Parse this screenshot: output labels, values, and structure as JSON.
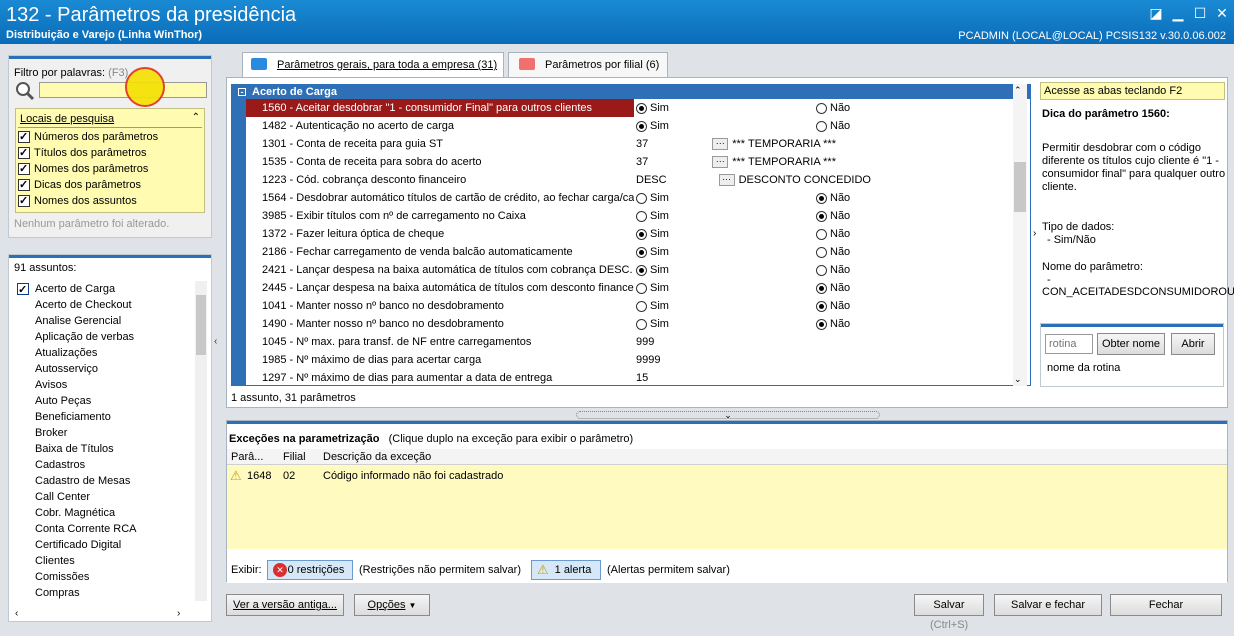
{
  "window": {
    "title": "132 - Parâmetros da presidência",
    "subtitle": "Distribuição e Varejo (Linha WinThor)",
    "user_info": "PCADMIN (LOCAL@LOCAL)   PCSIS132  v.30.0.06.002"
  },
  "filter": {
    "label": "Filtro por palavras:",
    "shortcut": "(F3)",
    "value": "",
    "locais_title": "Locais de pesquisa",
    "options": [
      "Números dos parâmetros",
      "Títulos dos parâmetros",
      "Nomes dos parâmetros",
      "Dicas dos parâmetros",
      "Nomes dos assuntos"
    ],
    "status": "Nenhum parâmetro foi alterado."
  },
  "subjects": {
    "count_label": "91 assuntos:",
    "items": [
      "Acerto de Carga",
      "Acerto de Checkout",
      "Analise Gerencial",
      "Aplicação de verbas",
      "Atualizações",
      "Autosserviço",
      "Avisos",
      "Auto Peças",
      "Beneficiamento",
      "Broker",
      "Baixa de Títulos",
      "Cadastros",
      "Cadastro de Mesas",
      "Call Center",
      "Cobr. Magnética",
      "Conta Corrente RCA",
      "Certificado Digital",
      "Clientes",
      "Comissões",
      "Compras"
    ]
  },
  "tabs": [
    {
      "label": "Parâmetros gerais, para toda a empresa (31)"
    },
    {
      "label": "Parâmetros por filial  (6)"
    }
  ],
  "grid": {
    "group": "Acerto de Carga",
    "rows": [
      {
        "name": "1560 - Aceitar desdobrar \"1 - consumidor Final\" para outros clientes",
        "v1": "Sim",
        "v2": "Não"
      },
      {
        "name": "1482 - Autenticação no acerto de carga",
        "v1": "Sim",
        "v2": "Não"
      },
      {
        "name": "1301 - Conta de receita para guia ST",
        "v1": "37",
        "v2": "*** TEMPORARIA ***"
      },
      {
        "name": "1535 - Conta de receita para sobra do acerto",
        "v1": "37",
        "v2": "*** TEMPORARIA ***"
      },
      {
        "name": "1223 - Cód. cobrança desconto financeiro",
        "v1": "DESC",
        "v2": "DESCONTO CONCEDIDO"
      },
      {
        "name": "1564 - Desdobrar automático títulos de cartão de crédito, ao fechar carga/ca",
        "v1": "Sim",
        "v2": "Não"
      },
      {
        "name": "3985 - Exibir títulos com nº de carregamento no Caixa",
        "v1": "Sim",
        "v2": "Não"
      },
      {
        "name": "1372 - Fazer leitura óptica de cheque",
        "v1": "Sim",
        "v2": "Não"
      },
      {
        "name": "2186 - Fechar carregamento de venda balcão automaticamente",
        "v1": "Sim",
        "v2": "Não"
      },
      {
        "name": "2421 - Lançar despesa na baixa automática de títulos com cobrança DESC.",
        "v1": "Sim",
        "v2": "Não"
      },
      {
        "name": "2445 - Lançar despesa na baixa automática de títulos com desconto financeir",
        "v1": "Sim",
        "v2": "Não"
      },
      {
        "name": "1041 - Manter nosso nº banco no desdobramento",
        "v1": "Sim",
        "v2": "Não"
      },
      {
        "name": "1490 - Manter nosso nº banco no desdobramento",
        "v1": "Sim",
        "v2": "Não"
      },
      {
        "name": "1045 - Nº max. para transf. de NF entre carregamentos",
        "v1": "999",
        "v2": ""
      },
      {
        "name": "1985 - Nº máximo de dias para acertar carga",
        "v1": "9999",
        "v2": ""
      },
      {
        "name": "1297 - Nº máximo de dias para aumentar a data de entrega",
        "v1": "15",
        "v2": ""
      }
    ],
    "footer": "1 assunto, 31 parâmetros"
  },
  "tip": {
    "hint": "Acesse as abas teclando F2",
    "title": "Dica do parâmetro 1560:",
    "text1": "Permitir desdobrar com o código",
    "text2": "diferente os títulos cujo cliente é \"1 -",
    "text3": "consumidor final\" para qualquer outro",
    "text4": "cliente.",
    "type_label": "Tipo de dados:",
    "type_value": "- Sim/Não",
    "name_label": "Nome do parâmetro:",
    "name_dash": "-",
    "name_value": "CON_ACEITADESDCONSUMIDOROUT"
  },
  "rotina": {
    "placeholder": "rotina",
    "get_name": "Obter nome",
    "open": "Abrir",
    "name_label": "nome da rotina"
  },
  "exceptions": {
    "title": "Exceções na parametrização",
    "hint": "(Clique duplo na exceção para exibir o parâmetro)",
    "cols": [
      "Parâ...",
      "Filial",
      "Descrição da exceção"
    ],
    "row": {
      "param": "1648",
      "filial": "02",
      "desc": "Código informado não foi cadastrado"
    },
    "show_label": "Exibir:",
    "restrictions_btn": "0 restrições",
    "restrictions_note": "(Restrições não permitem salvar)",
    "alerts_btn": "1 alerta",
    "alerts_note": "(Alertas permitem salvar)"
  },
  "footer_buttons": {
    "old_version": "Ver a versão antiga...",
    "options": "Opções",
    "save": "Salvar",
    "save_shortcut": "(Ctrl+S)",
    "save_close": "Salvar e fechar",
    "close": "Fechar"
  },
  "colors": {
    "title_blue": "#0a6cb8",
    "accent": "#2f6fb6",
    "selected_row": "#9a1a1a",
    "highlight_yellow": "#fffbb0"
  }
}
